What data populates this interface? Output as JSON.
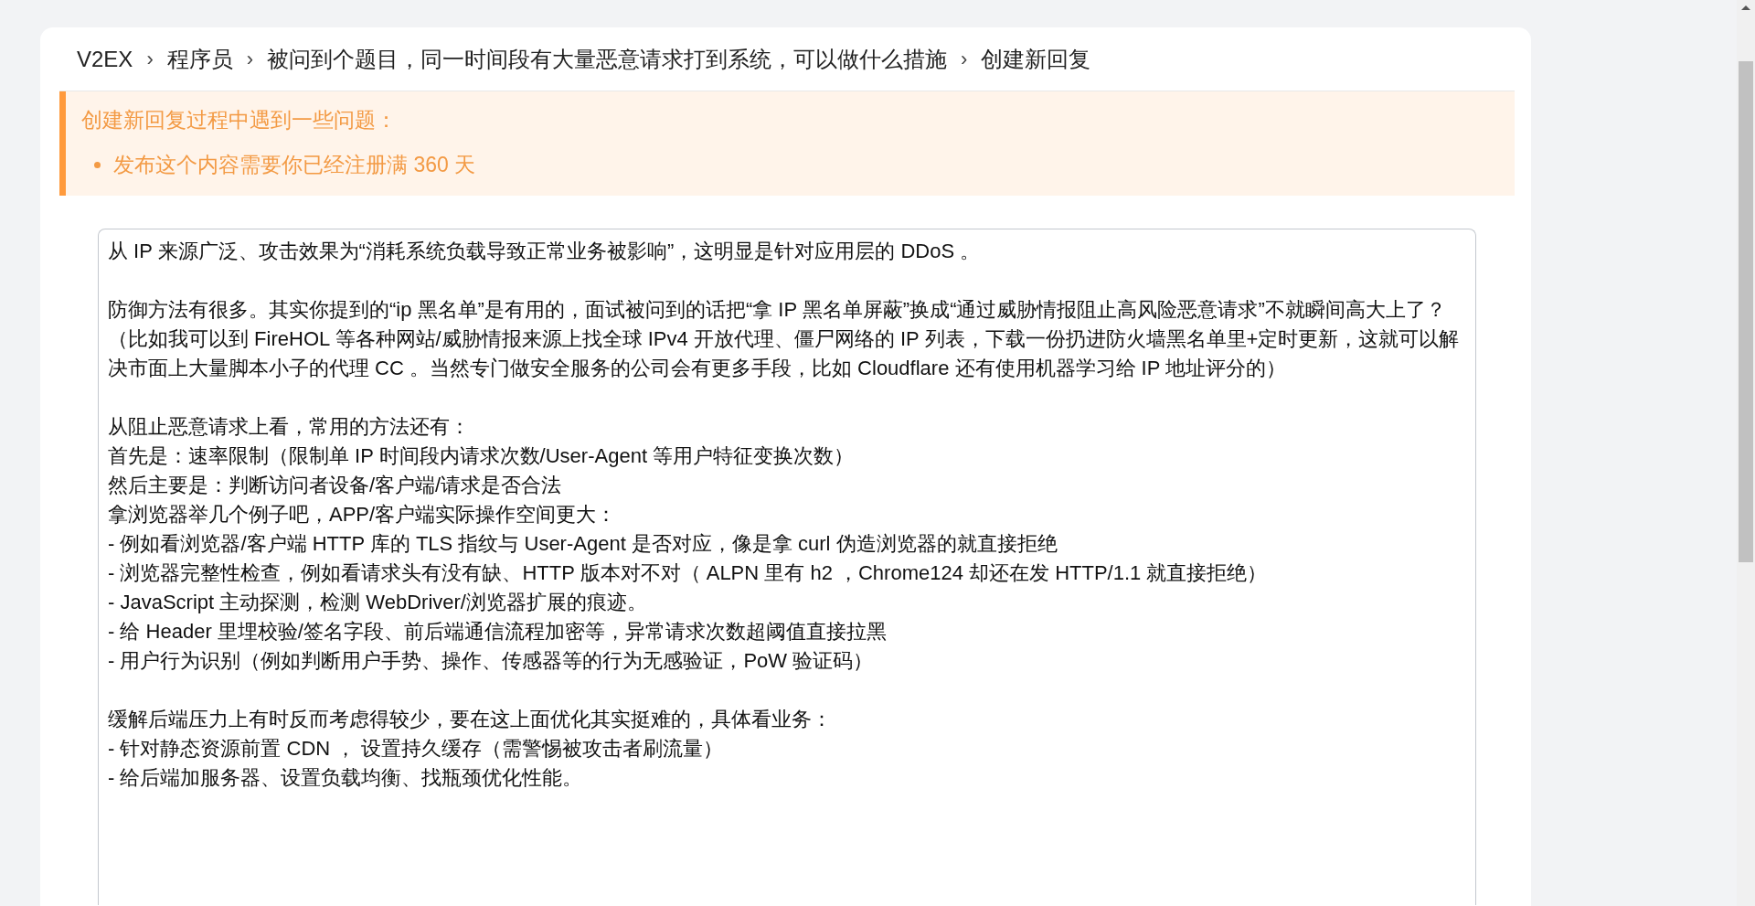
{
  "breadcrumb": [
    {
      "label": "V2EX"
    },
    {
      "label": "程序员"
    },
    {
      "label": "被问到个题目，同一时间段有大量恶意请求打到系统，可以做什么措施"
    },
    {
      "label": "创建新回复"
    }
  ],
  "breadcrumb_separator": "›",
  "alert": {
    "title": "创建新回复过程中遇到一些问题：",
    "problems": [
      "发布这个内容需要你已经注册满 360 天"
    ]
  },
  "reply_field": {
    "paragraphs": [
      [
        "从 IP 来源广泛、攻击效果为“消耗系统负载导致正常业务被影响”，这明显是针对应用层的 DDoS 。"
      ],
      [
        "防御方法有很多。其实你提到的“ip 黑名单”是有用的，面试被问到的话把“拿 IP 黑名单屏蔽”换成“通过威胁情报阻止高风险恶意请求”不就瞬间高大上了？",
        "（比如我可以到 FireHOL 等各种网站/威胁情报来源上找全球 IPv4 开放代理、僵尸网络的 IP 列表，下载一份扔进防火墙黑名单里+定时更新，这就可以解决市面上大量脚本小子的代理 CC 。当然专门做安全服务的公司会有更多手段，比如 Cloudflare 还有使用机器学习给 IP 地址评分的）"
      ],
      [
        "从阻止恶意请求上看，常用的方法还有：",
        "首先是：速率限制（限制单 IP 时间段内请求次数/User-Agent 等用户特征变换次数）",
        "然后主要是：判断访问者设备/客户端/请求是否合法",
        "拿浏览器举几个例子吧，APP/客户端实际操作空间更大：",
        "- 例如看浏览器/客户端 HTTP 库的 TLS 指纹与 User-Agent 是否对应，像是拿 curl 伪造浏览器的就直接拒绝",
        "- 浏览器完整性检查，例如看请求头有没有缺、HTTP 版本对不对（ ALPN 里有 h2 ，Chrome124 却还在发 HTTP/1.1 就直接拒绝）",
        "- JavaScript 主动探测，检测 WebDriver/浏览器扩展的痕迹。",
        "- 给 Header 里埋校验/签名字段、前后端通信流程加密等，异常请求次数超阈值直接拉黑",
        "- 用户行为识别（例如判断用户手势、操作、传感器等的行为无感验证，PoW 验证码）"
      ],
      [
        "缓解后端压力上有时反而考虑得较少，要在这上面优化其实挺难的，具体看业务：",
        "- 针对静态资源前置 CDN ， 设置持久缓存（需警惕被攻击者刷流量）",
        "- 给后端加服务器、设置负载均衡、找瓶颈优化性能。"
      ]
    ]
  }
}
